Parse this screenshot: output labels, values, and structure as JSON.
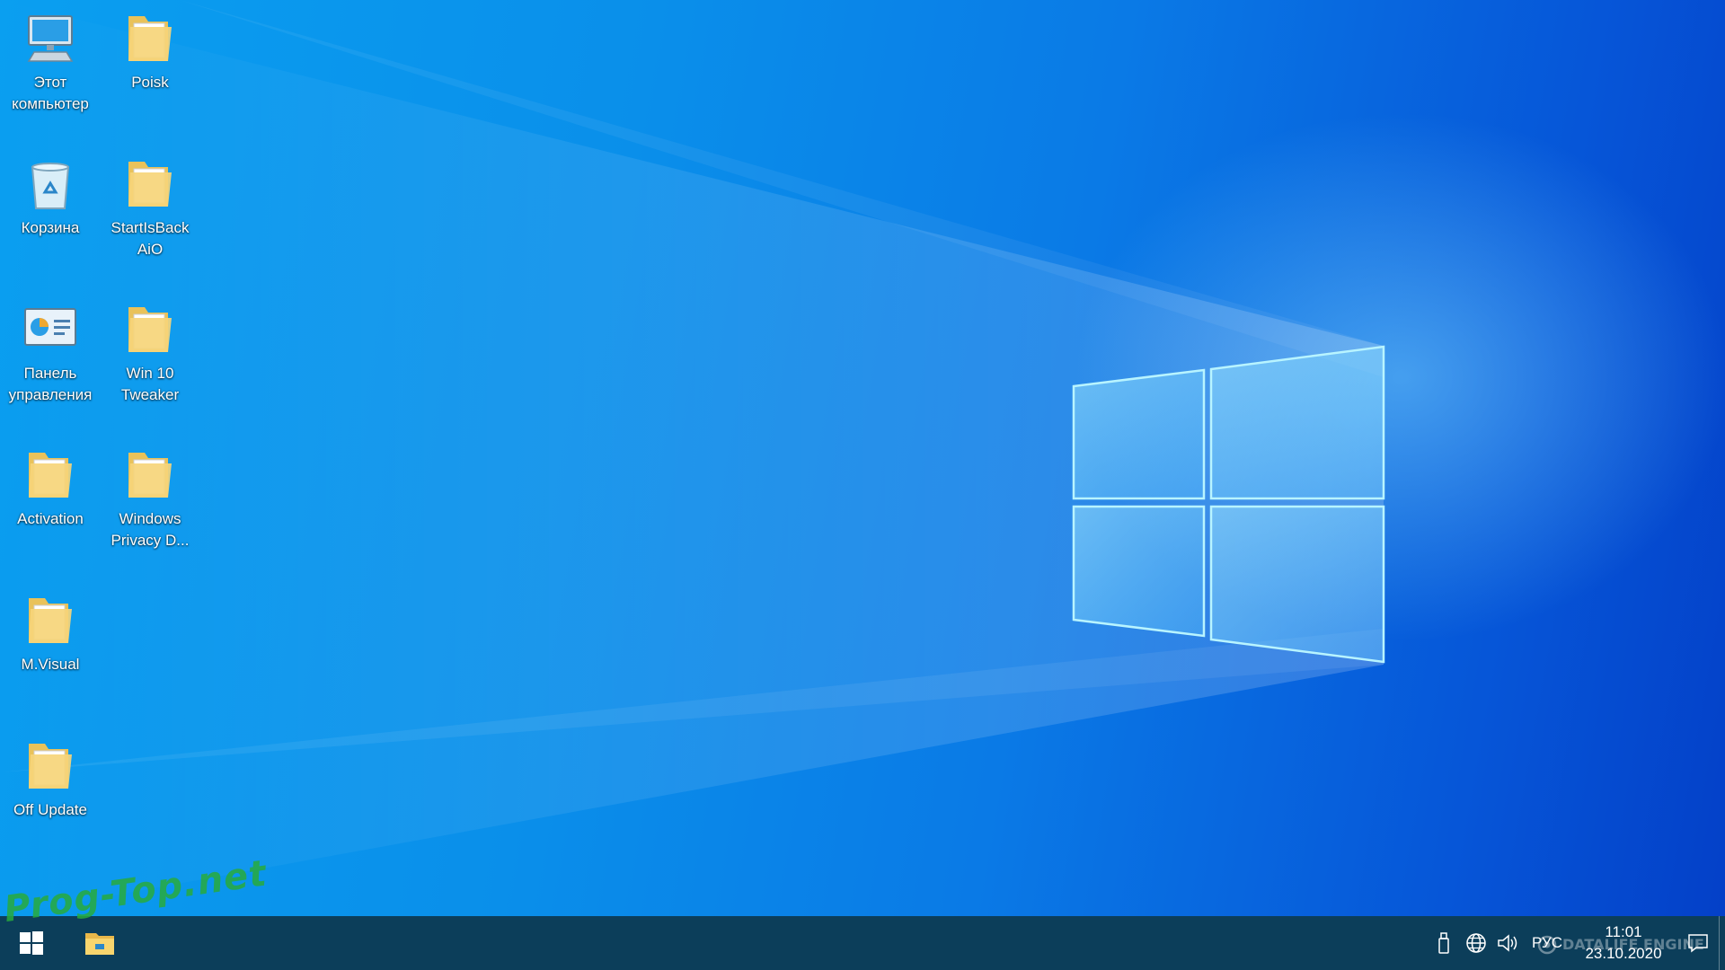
{
  "desktop": {
    "icons": [
      {
        "label": "Этот\nкомпьютер",
        "icon": "computer-icon"
      },
      {
        "label": "Poisk",
        "icon": "folder-icon"
      },
      {
        "label": "Корзина",
        "icon": "recycle-bin-icon"
      },
      {
        "label": "StartIsBack\nAiO",
        "icon": "folder-icon"
      },
      {
        "label": "Панель\nуправления",
        "icon": "control-panel-icon"
      },
      {
        "label": "Win 10\nTweaker",
        "icon": "folder-icon"
      },
      {
        "label": "Activation",
        "icon": "folder-icon"
      },
      {
        "label": "Windows\nPrivacy D...",
        "icon": "folder-icon"
      },
      {
        "label": "M.Visual",
        "icon": "folder-icon"
      },
      {
        "label": "Off Update",
        "icon": "folder-icon"
      }
    ],
    "watermark": "Prog-Top.net"
  },
  "taskbar": {
    "start_icon": "windows-logo-icon",
    "pinned": [
      {
        "icon": "file-explorer-icon"
      }
    ],
    "tray": {
      "icons": [
        "usb-drive-icon",
        "globe-network-icon",
        "speaker-volume-icon"
      ],
      "language": "РУС",
      "time": "11:01",
      "date": "23.10.2020",
      "watermark": "DATALIFE ENGINE"
    }
  },
  "colors": {
    "taskbar": "#0c3e5a",
    "desktop_light": "#0a9ff0",
    "desktop_dark": "#0440c8",
    "folder": "#f6d57a"
  }
}
